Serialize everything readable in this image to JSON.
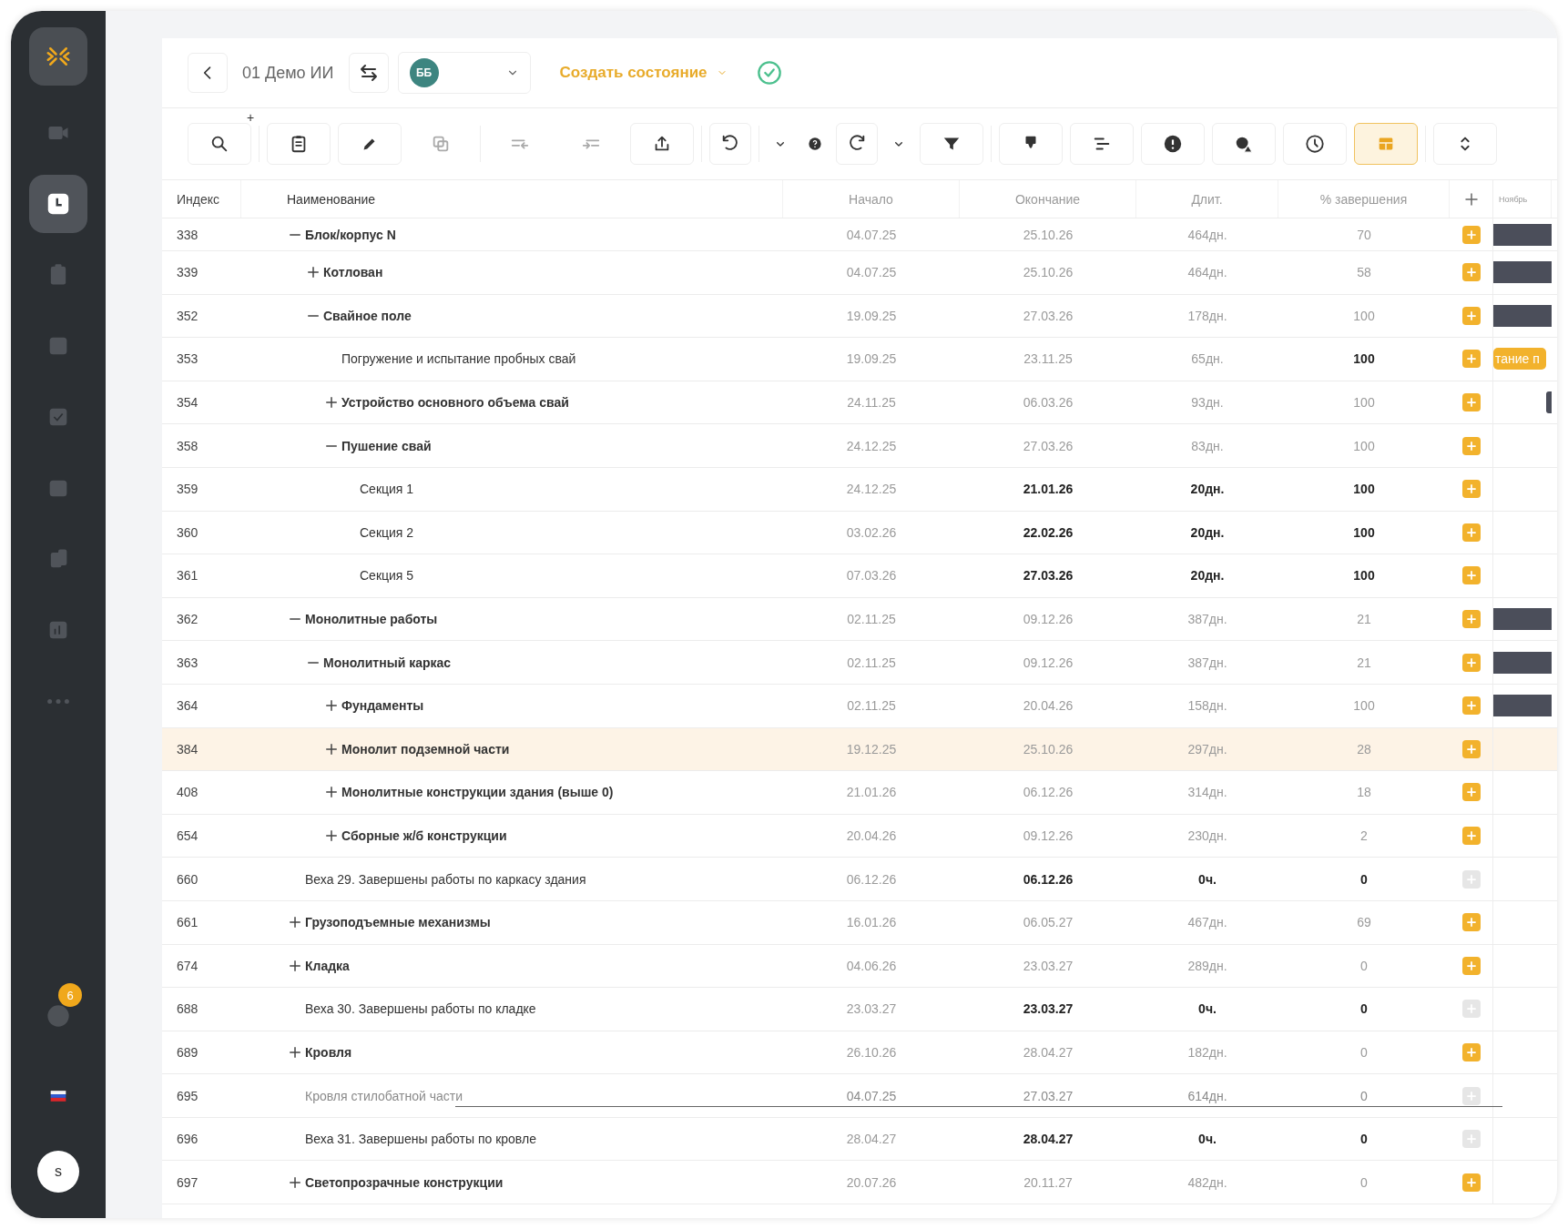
{
  "sidebar": {
    "items": [
      {
        "selected": false
      },
      {
        "selected": true
      },
      {
        "selected": false
      },
      {
        "selected": false
      },
      {
        "selected": false
      },
      {
        "selected": false
      },
      {
        "selected": false
      },
      {
        "selected": false
      },
      {
        "selected": false
      }
    ],
    "help_badge": "6",
    "avatar": "s"
  },
  "header": {
    "project": "01 Демо ИИ",
    "user_initials": "ББ",
    "create_state": "Создать состояние"
  },
  "toolbar": {
    "add_mark": "+",
    "items": [
      {
        "selected": false
      },
      {
        "selected": false
      },
      {
        "selected": false
      },
      {
        "selected": false
      },
      {
        "selected": false
      },
      {
        "selected": false
      },
      {
        "selected": false
      },
      {
        "selected": false
      },
      {
        "selected": false
      },
      {
        "selected": false
      },
      {
        "selected": false
      },
      {
        "selected": false
      },
      {
        "selected": false
      },
      {
        "selected": false
      },
      {
        "selected": false
      },
      {
        "selected": false
      },
      {
        "selected": false
      },
      {
        "selected": false
      },
      {
        "selected": true
      },
      {
        "selected": false
      }
    ]
  },
  "table": {
    "columns": [
      "Индекс",
      "Наименование",
      "Начало",
      "Окончание",
      "Длит.",
      "% завершения"
    ],
    "gantt_header": "Ноябрь",
    "rows": [
      {
        "index": "338",
        "name": "Блок/корпус N",
        "start": "04.07.25",
        "end": "25.10.26",
        "duration": "464дн.",
        "percent": "70",
        "kind": "group",
        "expanded": true,
        "selected": false,
        "cancelled": false,
        "add_enabled": true,
        "gantt": {
          "kind": "summary"
        },
        "children": [
          {
            "index": "339",
            "name": "Котлован",
            "start": "04.07.25",
            "end": "25.10.26",
            "duration": "464дн.",
            "percent": "58",
            "kind": "group",
            "expanded": false,
            "selected": false,
            "cancelled": false,
            "add_enabled": true,
            "gantt": {
              "kind": "summary"
            }
          },
          {
            "index": "352",
            "name": "Свайное поле",
            "start": "19.09.25",
            "end": "27.03.26",
            "duration": "178дн.",
            "percent": "100",
            "kind": "group",
            "expanded": true,
            "selected": false,
            "cancelled": false,
            "add_enabled": true,
            "gantt": {
              "kind": "summary"
            },
            "children": [
              {
                "index": "353",
                "name": "Погружение и испытание пробных свай",
                "start": "19.09.25",
                "end": "23.11.25",
                "duration": "65дн.",
                "percent": "100",
                "kind": "done",
                "selected": false,
                "cancelled": false,
                "add_enabled": true,
                "gantt": {
                  "kind": "task",
                  "label": "тание п"
                }
              },
              {
                "index": "354",
                "name": "Устройство основного объема свай",
                "start": "24.11.25",
                "end": "06.03.26",
                "duration": "93дн.",
                "percent": "100",
                "kind": "group",
                "expanded": false,
                "selected": false,
                "cancelled": false,
                "add_enabled": true,
                "gantt": {
                  "kind": "edge"
                }
              },
              {
                "index": "358",
                "name": "Пушение свай",
                "start": "24.12.25",
                "end": "27.03.26",
                "duration": "83дн.",
                "percent": "100",
                "kind": "group",
                "expanded": true,
                "selected": false,
                "cancelled": false,
                "add_enabled": true,
                "children": [
                  {
                    "index": "359",
                    "name": "Секция 1",
                    "start": "24.12.25",
                    "end": "21.01.26",
                    "duration": "20дн.",
                    "percent": "100",
                    "kind": "task",
                    "selected": false,
                    "cancelled": false,
                    "add_enabled": true
                  },
                  {
                    "index": "360",
                    "name": "Секция 2",
                    "start": "03.02.26",
                    "end": "22.02.26",
                    "duration": "20дн.",
                    "percent": "100",
                    "kind": "task",
                    "selected": false,
                    "cancelled": false,
                    "add_enabled": true
                  },
                  {
                    "index": "361",
                    "name": "Секция 5",
                    "start": "07.03.26",
                    "end": "27.03.26",
                    "duration": "20дн.",
                    "percent": "100",
                    "kind": "task",
                    "selected": false,
                    "cancelled": false,
                    "add_enabled": true
                  }
                ]
              }
            ]
          }
        ]
      },
      {
        "index": "362",
        "name": "Монолитные работы",
        "start": "02.11.25",
        "end": "09.12.26",
        "duration": "387дн.",
        "percent": "21",
        "kind": "group",
        "expanded": true,
        "selected": false,
        "cancelled": false,
        "add_enabled": true,
        "gantt": {
          "kind": "summary"
        },
        "children": [
          {
            "index": "363",
            "name": "Монолитный каркас",
            "start": "02.11.25",
            "end": "09.12.26",
            "duration": "387дн.",
            "percent": "21",
            "kind": "group",
            "expanded": true,
            "selected": false,
            "cancelled": false,
            "add_enabled": true,
            "gantt": {
              "kind": "summary"
            },
            "children": [
              {
                "index": "364",
                "name": "Фундаменты",
                "start": "02.11.25",
                "end": "20.04.26",
                "duration": "158дн.",
                "percent": "100",
                "kind": "group",
                "expanded": false,
                "selected": false,
                "cancelled": false,
                "add_enabled": true,
                "gantt": {
                  "kind": "summary"
                }
              },
              {
                "index": "384",
                "name": "Монолит подземной части",
                "start": "19.12.25",
                "end": "25.10.26",
                "duration": "297дн.",
                "percent": "28",
                "kind": "group",
                "expanded": false,
                "selected": true,
                "cancelled": false,
                "add_enabled": true
              },
              {
                "index": "408",
                "name": "Монолитные конструкции здания (выше 0)",
                "start": "21.01.26",
                "end": "06.12.26",
                "duration": "314дн.",
                "percent": "18",
                "kind": "group",
                "expanded": false,
                "selected": false,
                "cancelled": false,
                "add_enabled": true
              },
              {
                "index": "654",
                "name": "Сборные ж/б конструкции",
                "start": "20.04.26",
                "end": "09.12.26",
                "duration": "230дн.",
                "percent": "2",
                "kind": "group",
                "expanded": false,
                "selected": false,
                "cancelled": false,
                "add_enabled": true
              }
            ]
          }
        ]
      },
      {
        "index": "660",
        "name": "Веха 29. Завершены работы по каркасу здания",
        "start": "06.12.26",
        "end": "06.12.26",
        "duration": "0ч.",
        "percent": "0",
        "kind": "milestone",
        "selected": false,
        "cancelled": false,
        "add_enabled": false
      },
      {
        "index": "661",
        "name": "Грузоподъемные механизмы",
        "start": "16.01.26",
        "end": "06.05.27",
        "duration": "467дн.",
        "percent": "69",
        "kind": "group",
        "expanded": false,
        "selected": false,
        "cancelled": false,
        "add_enabled": true
      },
      {
        "index": "674",
        "name": "Кладка",
        "start": "04.06.26",
        "end": "23.03.27",
        "duration": "289дн.",
        "percent": "0",
        "kind": "group",
        "expanded": false,
        "selected": false,
        "cancelled": false,
        "add_enabled": true
      },
      {
        "index": "688",
        "name": "Веха 30. Завершены работы по кладке",
        "start": "23.03.27",
        "end": "23.03.27",
        "duration": "0ч.",
        "percent": "0",
        "kind": "milestone",
        "selected": false,
        "cancelled": false,
        "add_enabled": false
      },
      {
        "index": "689",
        "name": "Кровля",
        "start": "26.10.26",
        "end": "28.04.27",
        "duration": "182дн.",
        "percent": "0",
        "kind": "group",
        "expanded": false,
        "selected": false,
        "cancelled": false,
        "add_enabled": true
      },
      {
        "index": "695",
        "name": "Кровля стилобатной части",
        "start": "04.07.25",
        "end": "27.03.27",
        "duration": "614дн.",
        "percent": "0",
        "kind": "plain",
        "selected": false,
        "cancelled": true,
        "add_enabled": false
      },
      {
        "index": "696",
        "name": "Веха 31. Завершены работы по кровле",
        "start": "28.04.27",
        "end": "28.04.27",
        "duration": "0ч.",
        "percent": "0",
        "kind": "milestone",
        "selected": false,
        "cancelled": false,
        "add_enabled": false
      },
      {
        "index": "697",
        "name": "Светопрозрачные конструкции",
        "start": "20.07.26",
        "end": "20.11.27",
        "duration": "482дн.",
        "percent": "0",
        "kind": "group",
        "expanded": false,
        "selected": false,
        "cancelled": false,
        "add_enabled": true
      }
    ]
  }
}
